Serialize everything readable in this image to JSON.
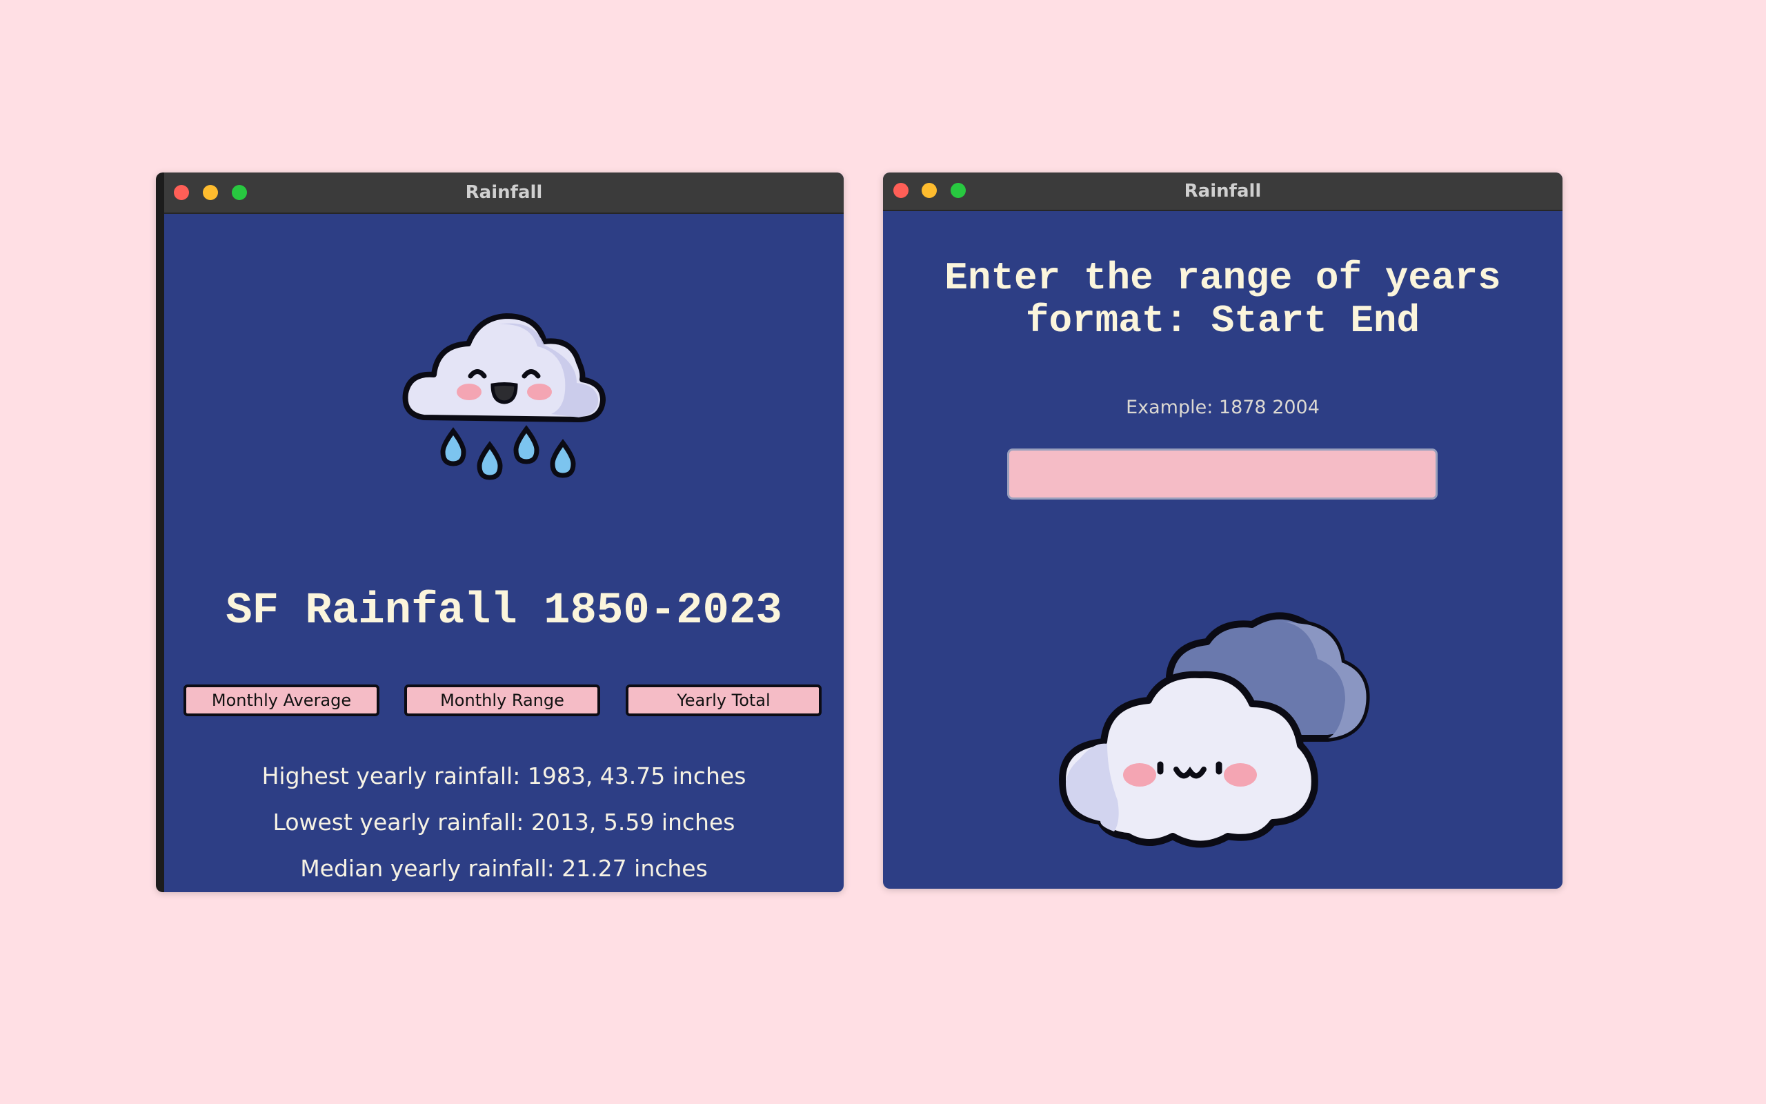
{
  "windows": {
    "left": {
      "title": "Rainfall",
      "heading": "SF Rainfall 1850-2023",
      "buttons": {
        "monthly_average": "Monthly Average",
        "monthly_range": "Monthly Range",
        "yearly_total": "Yearly Total"
      },
      "stats": {
        "highest": "Highest yearly rainfall: 1983, 43.75 inches",
        "lowest": "Lowest yearly rainfall: 2013, 5.59 inches",
        "median": "Median yearly rainfall: 21.27 inches"
      }
    },
    "right": {
      "title": "Rainfall",
      "heading_line1": "Enter the range of years",
      "heading_line2": "format: Start End",
      "example": "Example: 1878 2004",
      "input_value": ""
    }
  },
  "icons": {
    "rain_cloud": "rain-cloud-icon",
    "clouds": "clouds-icon"
  },
  "colors": {
    "background": "#ffdfe4",
    "window_body": "#2d3e85",
    "button_fill": "#f5bcc6",
    "heading_text": "#fbf5dc"
  }
}
